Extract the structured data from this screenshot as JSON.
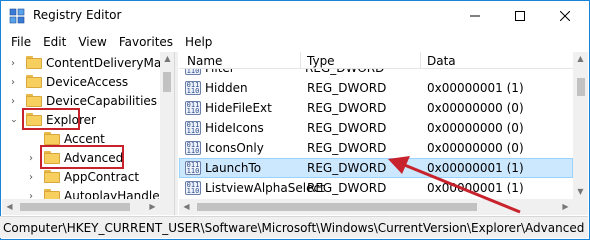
{
  "window": {
    "title": "Registry Editor",
    "accent_color": "#1883d7"
  },
  "menu": [
    "File",
    "Edit",
    "View",
    "Favorites",
    "Help"
  ],
  "tree": {
    "items": [
      {
        "label": "ContentDeliveryManager",
        "expanded": false
      },
      {
        "label": "DeviceAccess",
        "expanded": false
      },
      {
        "label": "DeviceCapabilities",
        "expanded": false
      },
      {
        "label": "Explorer",
        "expanded": true
      },
      {
        "label": "Accent",
        "expanded": false
      },
      {
        "label": "Advanced",
        "expanded": false
      },
      {
        "label": "AppContract",
        "expanded": false
      },
      {
        "label": "AutoplayHandlers",
        "expanded": false
      }
    ]
  },
  "list": {
    "columns": [
      "Name",
      "Type",
      "Data"
    ],
    "rows": [
      {
        "name": "Hidden",
        "type": "REG_DWORD",
        "data": "0x00000001 (1)"
      },
      {
        "name": "HideFileExt",
        "type": "REG_DWORD",
        "data": "0x00000000 (0)"
      },
      {
        "name": "HideIcons",
        "type": "REG_DWORD",
        "data": "0x00000000 (0)"
      },
      {
        "name": "IconsOnly",
        "type": "REG_DWORD",
        "data": "0x00000000 (0)"
      },
      {
        "name": "LaunchTo",
        "type": "REG_DWORD",
        "data": "0x00000001 (1)",
        "selected": true
      },
      {
        "name": "ListviewAlphaSelect",
        "type": "REG_DWORD",
        "data": "0x00000001 (1)"
      }
    ],
    "partial_top_row": {
      "name": "Filter",
      "type": "REG_DWORD"
    }
  },
  "status": {
    "path": "Computer\\HKEY_CURRENT_USER\\Software\\Microsoft\\Windows\\CurrentVersion\\Explorer\\Advanced"
  },
  "annotation": {
    "color": "#c8232c"
  }
}
